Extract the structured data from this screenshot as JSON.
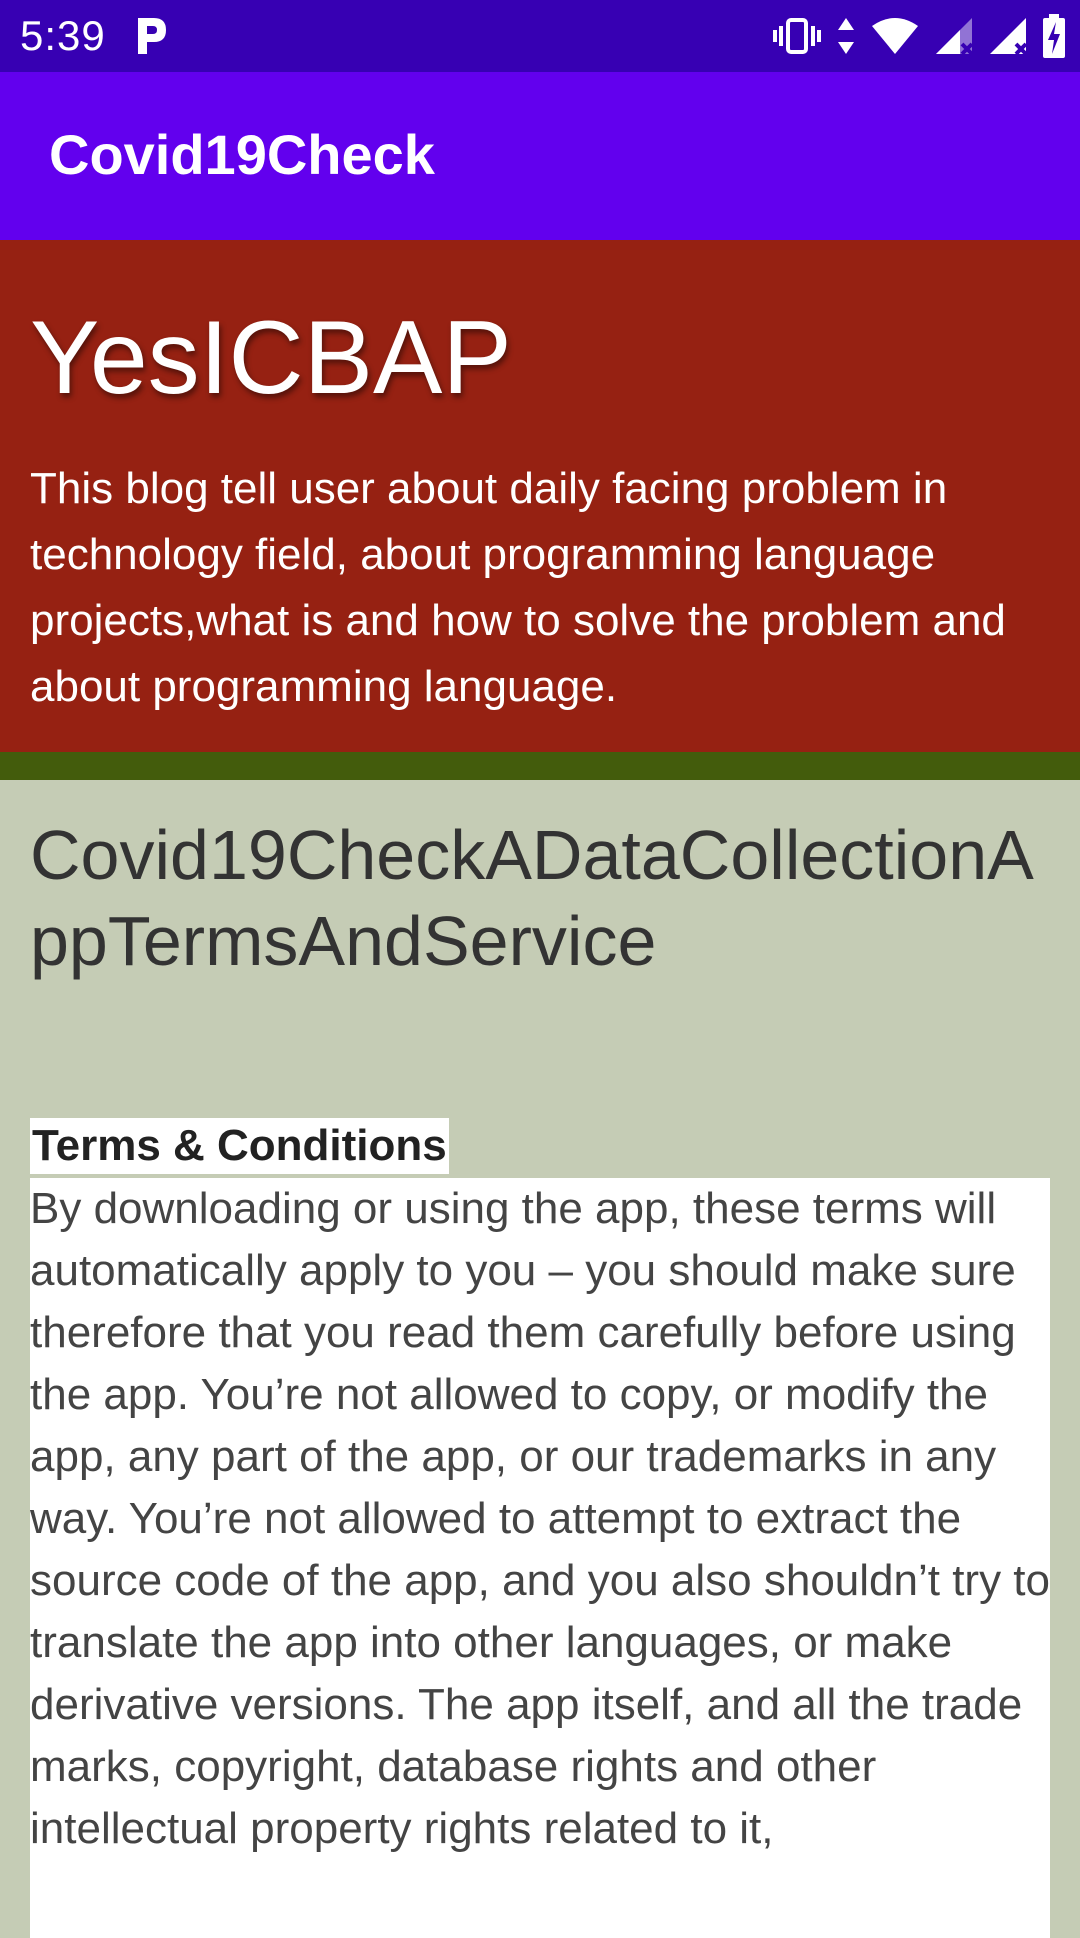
{
  "status_bar": {
    "time": "5:39",
    "notification_icon": "parking-p-icon",
    "icons": [
      "vibrate-icon",
      "data-arrows-icon",
      "wifi-icon",
      "signal-icon",
      "signal-icon",
      "battery-charging-icon"
    ]
  },
  "app_bar": {
    "title": "Covid19Check"
  },
  "blog_header": {
    "title": "YesICBAP",
    "description": "This blog tell user about daily facing problem in technology field, about programming language projects,what is and how to solve the problem and about programming language."
  },
  "post": {
    "title": "Covid19CheckADataCollectionAppTermsAndService",
    "section_heading": "Terms & Conditions",
    "body": "By downloading or using the app, these terms will automatically apply to you – you should make sure therefore that you read them carefully before using the app. You’re not allowed to copy, or modify the app, any part of the app, or our trademarks in any way. You’re not allowed to attempt to extract the source code of the app, and you also shouldn’t try to translate the app into other languages, or make derivative versions. The app itself, and all the trade marks, copyright, database rights and other intellectual property rights related to it,"
  },
  "colors": {
    "status_bar": "#3700b3",
    "app_bar": "#6200ee",
    "blog_header": "#962112",
    "green_strip": "#435c0c",
    "content_bg": "#c5ccb5"
  }
}
